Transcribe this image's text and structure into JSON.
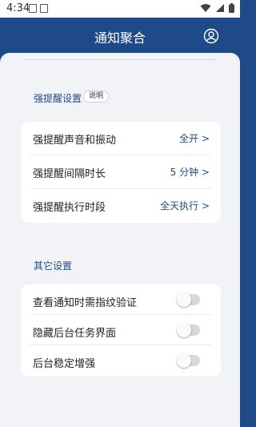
{
  "status_bar": {
    "time": "4:34"
  },
  "header": {
    "title": "通知聚合"
  },
  "strong_reminder": {
    "section_title": "强提醒设置",
    "help_label": "说明",
    "rows": [
      {
        "label": "强提醒声音和振动",
        "value": "全开 >"
      },
      {
        "label": "强提醒间隔时长",
        "value": "5 分钟 >"
      },
      {
        "label": "强提醒执行时段",
        "value": "全天执行 >"
      }
    ]
  },
  "other": {
    "section_title": "其它设置",
    "rows": [
      {
        "label": "查看通知时需指纹验证",
        "enabled": false
      },
      {
        "label": "隐藏后台任务界面",
        "enabled": false
      },
      {
        "label": "后台稳定增强",
        "enabled": false
      }
    ]
  },
  "colors": {
    "brand": "#1f4a8a",
    "background": "#f2f3f7"
  }
}
